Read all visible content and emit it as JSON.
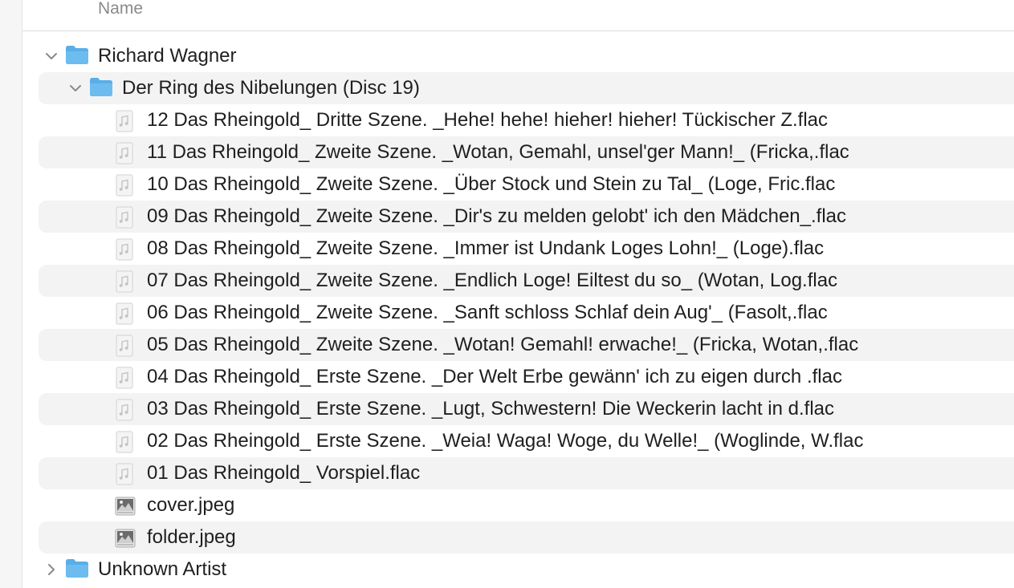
{
  "window": {
    "column_header": "Name"
  },
  "colors": {
    "folder_blue": "#5aaee8",
    "row_stripe": "#f3f3f3",
    "text": "#1f1f1f",
    "header_text": "#8a8a8a"
  },
  "tree": {
    "artist1": {
      "name": "Richard Wagner",
      "expanded": true,
      "icon": "folder-icon"
    },
    "album": {
      "name": "Der Ring des Nibelungen (Disc 19)",
      "expanded": true,
      "icon": "folder-icon"
    },
    "files": [
      {
        "name": "12 Das Rheingold_ Dritte Szene. _Hehe! hehe! hieher! hieher! Tückischer Z.flac",
        "icon": "audio-file-icon"
      },
      {
        "name": "11 Das Rheingold_ Zweite Szene. _Wotan, Gemahl, unsel'ger Mann!_ (Fricka,.flac",
        "icon": "audio-file-icon"
      },
      {
        "name": "10 Das Rheingold_ Zweite Szene. _Über Stock und Stein zu Tal_ (Loge, Fric.flac",
        "icon": "audio-file-icon"
      },
      {
        "name": "09 Das Rheingold_ Zweite Szene. _Dir's zu melden gelobt' ich den Mädchen_.flac",
        "icon": "audio-file-icon"
      },
      {
        "name": "08 Das Rheingold_ Zweite Szene. _Immer ist Undank Loges Lohn!_ (Loge).flac",
        "icon": "audio-file-icon"
      },
      {
        "name": "07 Das Rheingold_ Zweite Szene. _Endlich Loge! Eiltest du so_ (Wotan, Log.flac",
        "icon": "audio-file-icon"
      },
      {
        "name": "06 Das Rheingold_ Zweite Szene. _Sanft schloss Schlaf dein Aug'_ (Fasolt,.flac",
        "icon": "audio-file-icon"
      },
      {
        "name": "05 Das Rheingold_ Zweite Szene. _Wotan! Gemahl! erwache!_ (Fricka, Wotan,.flac",
        "icon": "audio-file-icon"
      },
      {
        "name": "04 Das Rheingold_ Erste Szene. _Der Welt Erbe gewänn' ich zu eigen durch .flac",
        "icon": "audio-file-icon"
      },
      {
        "name": "03 Das Rheingold_ Erste Szene. _Lugt, Schwestern! Die Weckerin lacht in d.flac",
        "icon": "audio-file-icon"
      },
      {
        "name": "02 Das Rheingold_ Erste Szene. _Weia! Waga! Woge, du Welle!_ (Woglinde, W.flac",
        "icon": "audio-file-icon"
      },
      {
        "name": "01 Das Rheingold_ Vorspiel.flac",
        "icon": "audio-file-icon"
      },
      {
        "name": "cover.jpeg",
        "icon": "image-file-icon"
      },
      {
        "name": "folder.jpeg",
        "icon": "image-file-icon"
      }
    ],
    "artist2": {
      "name": "Unknown Artist",
      "expanded": false,
      "icon": "folder-icon"
    }
  }
}
